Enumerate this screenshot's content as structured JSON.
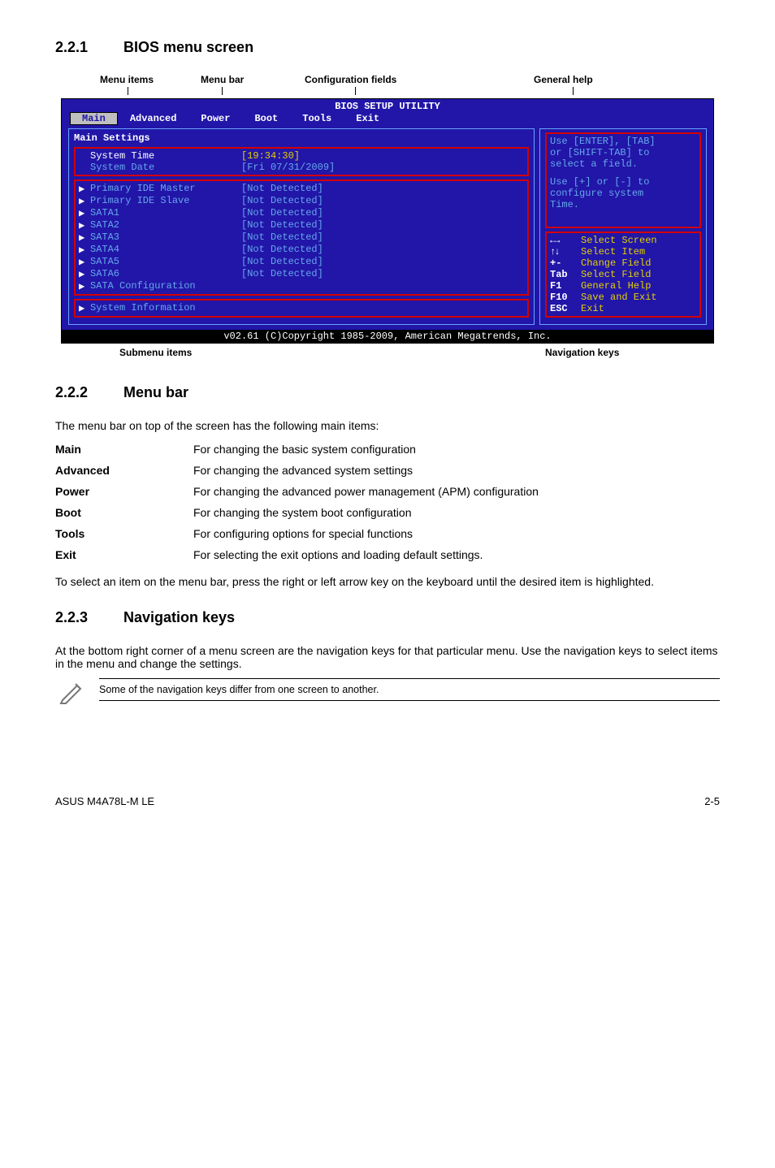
{
  "sect_221_num": "2.2.1",
  "sect_221_title": "BIOS menu screen",
  "labels": {
    "menu_items": "Menu items",
    "menu_bar": "Menu bar",
    "config_fields": "Configuration fields",
    "general_help": "General help",
    "submenu": "Submenu items",
    "navkeys": "Navigation keys"
  },
  "bios": {
    "title": "BIOS SETUP UTILITY",
    "tabs": {
      "main": "Main",
      "advanced": "Advanced",
      "power": "Power",
      "boot": "Boot",
      "tools": "Tools",
      "exit": "Exit"
    },
    "settings_hdr": "Main Settings",
    "systime_lab": "System Time",
    "systime_val": "[19:34:30]",
    "sysdate_lab": "System Date",
    "sysdate_val": "[Fri 07/31/2009]",
    "rows": [
      {
        "lab": "Primary IDE Master",
        "val": "[Not Detected]"
      },
      {
        "lab": "Primary IDE Slave",
        "val": "[Not Detected]"
      },
      {
        "lab": "SATA1",
        "val": "[Not Detected]"
      },
      {
        "lab": "SATA2",
        "val": "[Not Detected]"
      },
      {
        "lab": "SATA3",
        "val": "[Not Detected]"
      },
      {
        "lab": "SATA4",
        "val": "[Not Detected]"
      },
      {
        "lab": "SATA5",
        "val": "[Not Detected]"
      },
      {
        "lab": "SATA6",
        "val": "[Not Detected]"
      }
    ],
    "sata_cfg": "SATA Configuration",
    "sys_info": "System Information",
    "help1": "Use [ENTER], [TAB]",
    "help2": "or [SHIFT-TAB] to",
    "help3": "select a field.",
    "help4": "Use [+] or [-] to",
    "help5": "configure system",
    "help6": "Time.",
    "nav": {
      "sel_screen": "Select Screen",
      "sel_item": "Select Item",
      "change": "Change Field",
      "selectf": "Select Field",
      "general": "General Help",
      "save": "Save and Exit",
      "exit": "Exit",
      "k_lr": "←→",
      "k_ud": "↑↓",
      "k_pm": "+-",
      "k_tab": "Tab",
      "k_f1": "F1",
      "k_f10": "F10",
      "k_esc": "ESC"
    },
    "footer": "v02.61 (C)Copyright 1985-2009, American Megatrends, Inc."
  },
  "sect_222_num": "2.2.2",
  "sect_222_title": "Menu bar",
  "mb_intro": "The menu bar on top of the screen has the following main items:",
  "defs": {
    "Main_k": "Main",
    "Main_v": "For changing the basic system configuration",
    "Advanced_k": "Advanced",
    "Advanced_v": "For changing the advanced system settings",
    "Power_k": "Power",
    "Power_v": "For changing the advanced power management (APM) configuration",
    "Boot_k": "Boot",
    "Boot_v": "For changing the system boot configuration",
    "Tools_k": "Tools",
    "Tools_v": "For configuring options for special functions",
    "Exit_k": "Exit",
    "Exit_v": "For selecting the exit options and loading default settings."
  },
  "mb_outro": "To select an item on the menu bar, press the right or left arrow key on the keyboard until the desired item is highlighted.",
  "sect_223_num": "2.2.3",
  "sect_223_title": "Navigation keys",
  "nk_para": "At the bottom right corner of a menu screen are the navigation keys for that particular menu. Use the navigation keys to select items in the menu and change the settings.",
  "note": "Some of the navigation keys differ from one screen to another.",
  "footer_left": "ASUS M4A78L-M LE",
  "footer_right": "2-5"
}
